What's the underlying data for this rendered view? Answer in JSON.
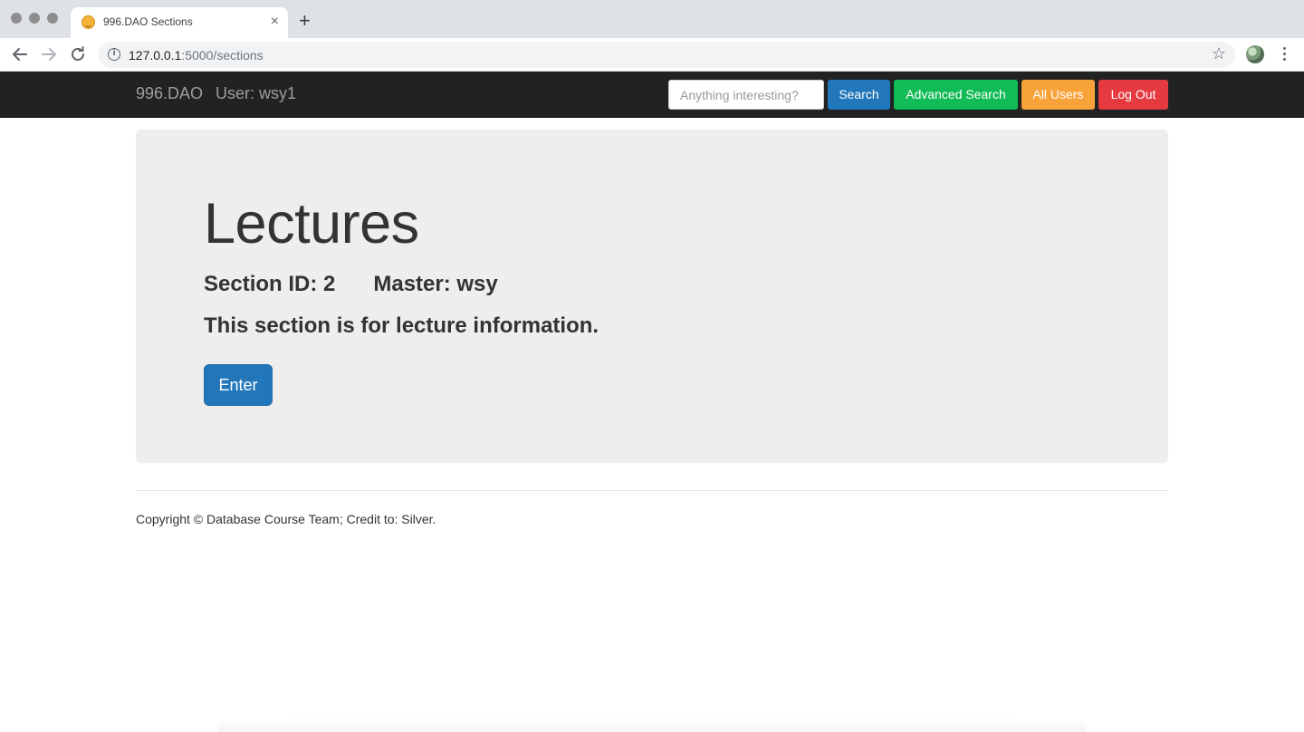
{
  "browser": {
    "tab_title": "996.DAO Sections",
    "tab_close": "×",
    "new_tab": "+",
    "url_host": "127.0.0.1",
    "url_path": ":5000/sections",
    "info_glyph": "i",
    "star_glyph": "☆",
    "icons": [
      "back-arrow-icon",
      "forward-arrow-icon",
      "reload-icon",
      "info-icon",
      "star-icon",
      "profile-avatar",
      "menu-dots-icon"
    ]
  },
  "navbar": {
    "brand": "996.DAO",
    "user_label": "User: wsy1",
    "search_placeholder": "Anything interesting?",
    "search_button": "Search",
    "advanced_search_button": "Advanced Search",
    "all_users_button": "All Users",
    "logout_button": "Log Out",
    "colors": {
      "background": "#222222",
      "search": "#2277bb",
      "advanced_search": "#11bb55",
      "all_users": "#f8a33a",
      "logout": "#e53a40"
    }
  },
  "section": {
    "title": "Lectures",
    "id_label": "Section ID: 2",
    "master_label": "Master: wsy",
    "description": "This section is for lecture information.",
    "enter_button": "Enter"
  },
  "footer": {
    "text": "Copyright © Database Course Team; Credit to: Silver."
  }
}
